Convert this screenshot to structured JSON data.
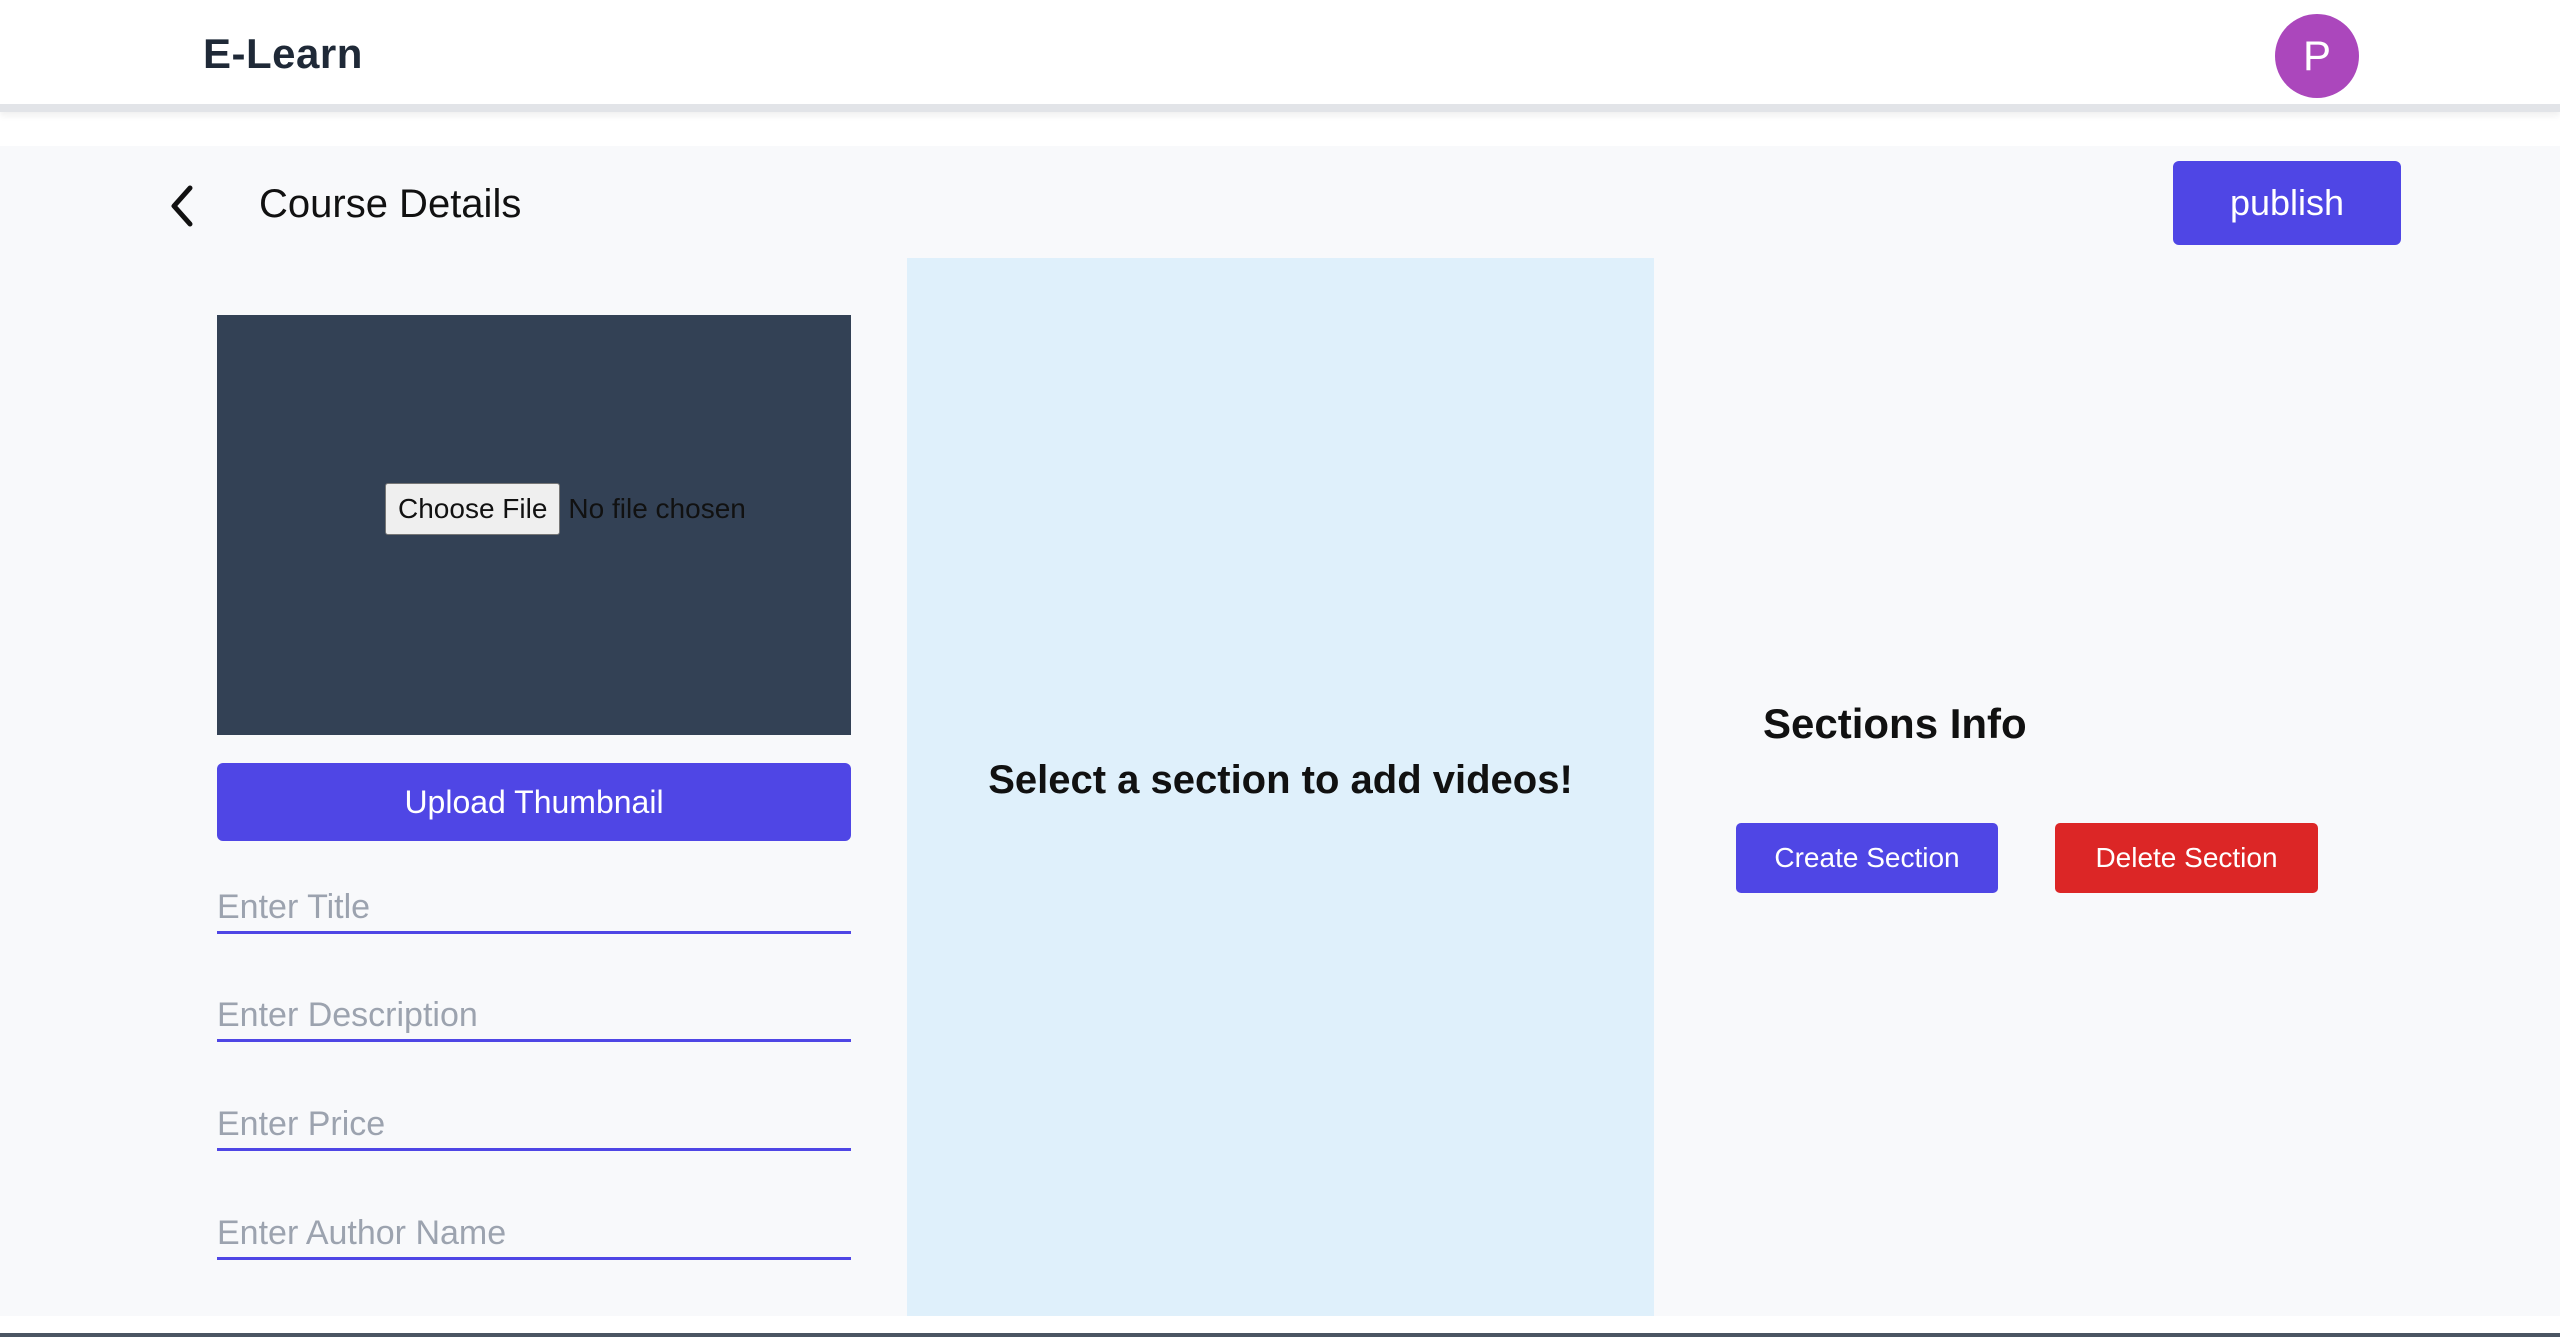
{
  "header": {
    "brand": "E-Learn",
    "avatar_initial": "P"
  },
  "page": {
    "title": "Course Details",
    "back_icon": "chevron-left-icon",
    "publish_label": "publish"
  },
  "thumbnail": {
    "choose_file_label": "Choose File",
    "file_status": "No file chosen",
    "upload_label": "Upload Thumbnail"
  },
  "form": {
    "title_placeholder": "Enter Title",
    "description_placeholder": "Enter Description",
    "price_placeholder": "Enter Price",
    "author_placeholder": "Enter Author Name"
  },
  "videos": {
    "empty_message": "Select a section to add videos!"
  },
  "sections": {
    "title": "Sections Info",
    "create_label": "Create Section",
    "delete_label": "Delete Section"
  },
  "colors": {
    "accent": "#4f46e5",
    "danger": "#dc2626",
    "avatar": "#ab47bc",
    "thumbnail_bg": "#334155",
    "videos_panel_bg": "#dff0fb"
  }
}
